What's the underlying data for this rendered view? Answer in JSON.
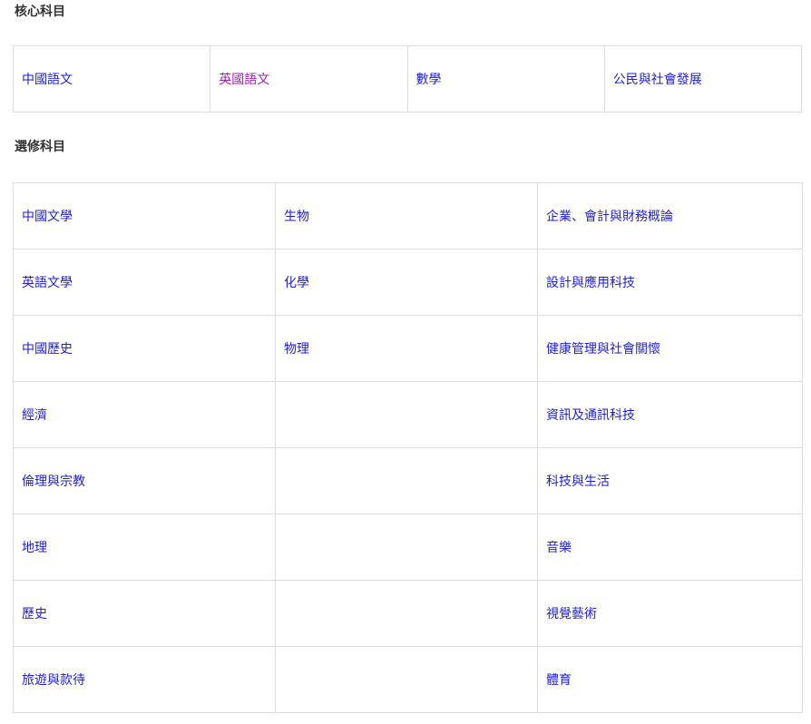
{
  "core": {
    "heading": "核心科目",
    "subjects": [
      "中國語文",
      "英國語文",
      "數學",
      "公民與社會發展"
    ],
    "visited_index": 1
  },
  "elective": {
    "heading": "選修科目",
    "rows": [
      [
        "中國文學",
        "生物",
        "企業、會計與財務概論"
      ],
      [
        "英語文學",
        "化學",
        "設計與應用科技"
      ],
      [
        "中國歷史",
        "物理",
        "健康管理與社會關懷"
      ],
      [
        "經濟",
        "",
        "資訊及通訊科技"
      ],
      [
        "倫理與宗教",
        "",
        "科技與生活"
      ],
      [
        "地理",
        "",
        "音樂"
      ],
      [
        "歷史",
        "",
        "視覺藝術"
      ],
      [
        "旅遊與款待",
        "",
        "體育"
      ]
    ]
  },
  "colors": {
    "link": "#1f1fd6",
    "visited_link": "#a020b0",
    "border": "#dcdcdc",
    "heading": "#333333"
  }
}
